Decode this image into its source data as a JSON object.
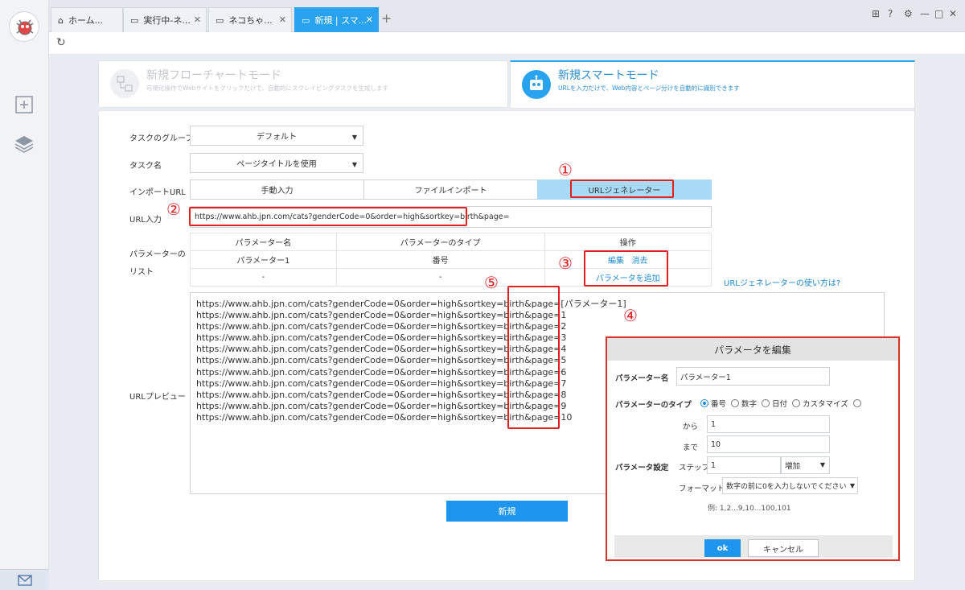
{
  "tabs": [
    {
      "label": "ホーム...",
      "icon": "home-icon"
    },
    {
      "label": "実行中-ネ...",
      "icon": "page-icon"
    },
    {
      "label": "ネコちゃ...",
      "icon": "page-icon"
    },
    {
      "label": "新規 | スマ...",
      "icon": "page-icon",
      "active": true
    }
  ],
  "modes": {
    "flowchart": {
      "title": "新規フローチャートモード",
      "subtitle": "可視化操作でWebサイトをクリックだけで、自動的にスクレイピングタスクを生成します"
    },
    "smart": {
      "title": "新規スマートモード",
      "subtitle": "URLを入力だけで、Web内容とページ分けを自動的に識別できます"
    }
  },
  "form": {
    "group_label": "タスクのグループ",
    "group_value": "デフォルト",
    "name_label": "タスク名",
    "name_value": "ページタイトルを使用",
    "import_label": "インポートURL",
    "import_options": [
      "手動入力",
      "ファイルインポート",
      "URLジェネレーター"
    ],
    "url_label": "URL入力",
    "url_value": "https://www.ahb.jpn.com/cats?genderCode=0&order=high&sortkey=birth&page=",
    "param_label": "パラメーターのリスト",
    "table_headers": [
      "パラメーター名",
      "パラメーターのタイプ",
      "操作"
    ],
    "row1": {
      "name": "パラメーター1",
      "type": "番号",
      "edit": "編集",
      "delete": "消去"
    },
    "row2": {
      "name": "-",
      "type": "-",
      "add": "パラメータを追加"
    },
    "help_link": "URLジェネレーターの使い方は?",
    "preview_label": "URLプレビュー",
    "preview_lines": [
      "https://www.ahb.jpn.com/cats?genderCode=0&order=high&sortkey=birth&page=[パラメーター1]",
      "https://www.ahb.jpn.com/cats?genderCode=0&order=high&sortkey=birth&page=1",
      "https://www.ahb.jpn.com/cats?genderCode=0&order=high&sortkey=birth&page=2",
      "https://www.ahb.jpn.com/cats?genderCode=0&order=high&sortkey=birth&page=3",
      "https://www.ahb.jpn.com/cats?genderCode=0&order=high&sortkey=birth&page=4",
      "https://www.ahb.jpn.com/cats?genderCode=0&order=high&sortkey=birth&page=5",
      "https://www.ahb.jpn.com/cats?genderCode=0&order=high&sortkey=birth&page=6",
      "https://www.ahb.jpn.com/cats?genderCode=0&order=high&sortkey=birth&page=7",
      "https://www.ahb.jpn.com/cats?genderCode=0&order=high&sortkey=birth&page=8",
      "https://www.ahb.jpn.com/cats?genderCode=0&order=high&sortkey=birth&page=9",
      "https://www.ahb.jpn.com/cats?genderCode=0&order=high&sortkey=birth&page=10"
    ],
    "create_label": "新規"
  },
  "dialog": {
    "title": "パラメータを編集",
    "name_label": "パラメーター名",
    "name_value": "パラメーター1",
    "type_label": "パラメーターのタイプ",
    "types": [
      "番号",
      "数字",
      "日付",
      "カスタマイズ"
    ],
    "from_label": "から",
    "from_value": "1",
    "to_label": "まで",
    "to_value": "10",
    "setting_label": "パラメータ設定",
    "step_label": "ステップ",
    "step_value": "1",
    "step_mode": "増加",
    "format_label": "フォーマット",
    "format_value": "数字の前に0を入力しないでください",
    "example": "例: 1,2...9,10...100,101",
    "ok_label": "ok",
    "cancel_label": "キャンセル"
  },
  "annotations": [
    "①",
    "②",
    "③",
    "④",
    "⑤"
  ],
  "colors": {
    "accent": "#1e95ef",
    "tab_active": "#29a3ef",
    "highlight": "#a8daf7",
    "annotation_red": "#e1201f"
  }
}
